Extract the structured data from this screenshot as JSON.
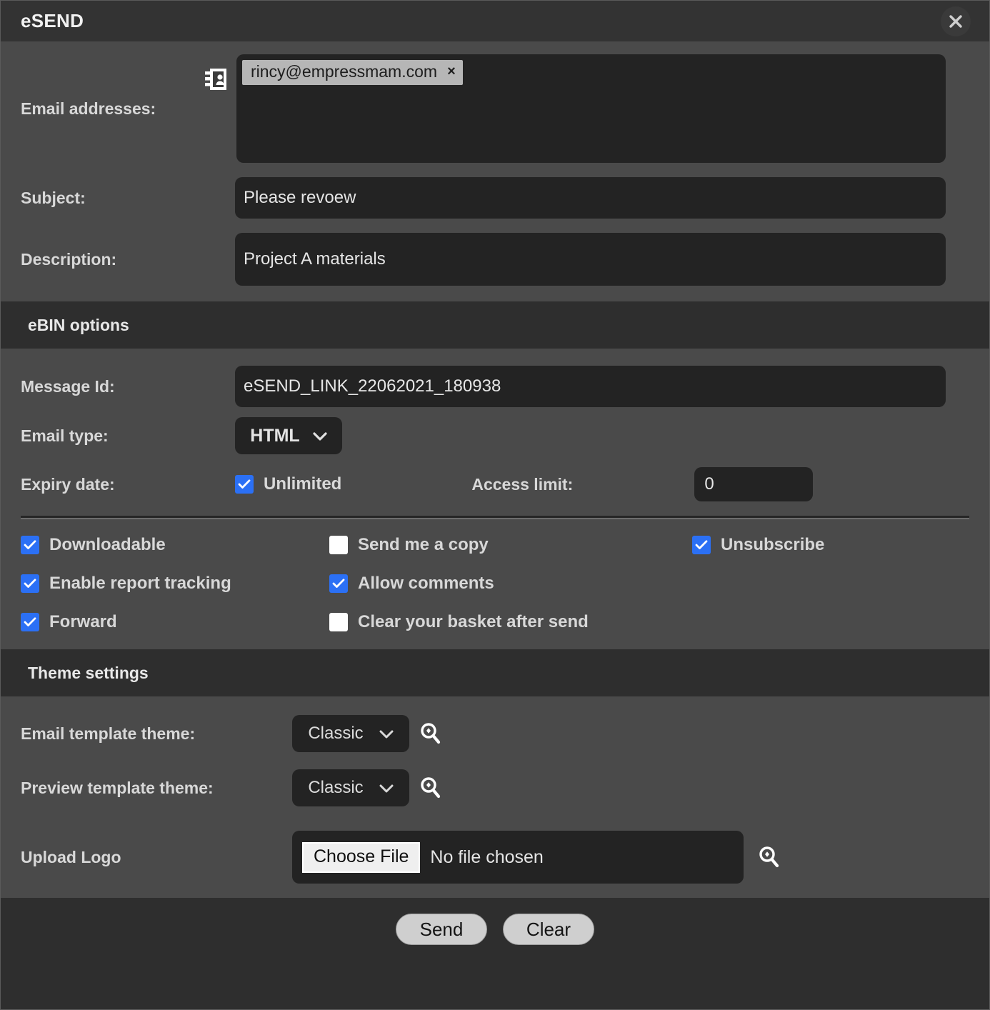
{
  "window": {
    "title": "eSEND",
    "close_icon": "close-icon"
  },
  "compose": {
    "email_label": "Email addresses:",
    "contact_icon": "contact-book-icon",
    "recipients": [
      {
        "address": "rincy@empressmam.com",
        "remove": "×"
      }
    ],
    "subject_label": "Subject:",
    "subject_value": "Please revoew",
    "description_label": "Description:",
    "description_value": "Project A materials"
  },
  "ebin": {
    "header": "eBIN options",
    "message_id_label": "Message Id:",
    "message_id_value": "eSEND_LINK_22062021_180938",
    "email_type_label": "Email type:",
    "email_type_value": "HTML",
    "email_type_options": [
      "HTML"
    ],
    "expiry_label": "Expiry date:",
    "unlimited_label": "Unlimited",
    "unlimited_checked": true,
    "access_limit_label": "Access limit:",
    "access_limit_value": "0",
    "options": [
      {
        "label": "Downloadable",
        "checked": true
      },
      {
        "label": "Send me a copy",
        "checked": false
      },
      {
        "label": "Unsubscribe",
        "checked": true
      },
      {
        "label": "Enable report tracking",
        "checked": true
      },
      {
        "label": "Allow comments",
        "checked": true
      },
      {
        "label": "",
        "checked": null
      },
      {
        "label": "Forward",
        "checked": true
      },
      {
        "label": "Clear your basket after send",
        "checked": false
      },
      {
        "label": "",
        "checked": null
      }
    ]
  },
  "theme": {
    "header": "Theme settings",
    "email_template_label": "Email template theme:",
    "email_template_value": "Classic",
    "email_template_options": [
      "Classic"
    ],
    "preview_template_label": "Preview template theme:",
    "preview_template_value": "Classic",
    "preview_template_options": [
      "Classic"
    ],
    "preview_icon": "magnifier-zoom-in-icon",
    "upload_logo_label": "Upload Logo",
    "choose_file_label": "Choose File",
    "no_file_label": "No file chosen"
  },
  "footer": {
    "send_label": "Send",
    "clear_label": "Clear"
  },
  "colors": {
    "accent": "#2b70f5",
    "panel": "#4a4a4a",
    "header_bar": "#2e2e2e",
    "field": "#232323"
  }
}
